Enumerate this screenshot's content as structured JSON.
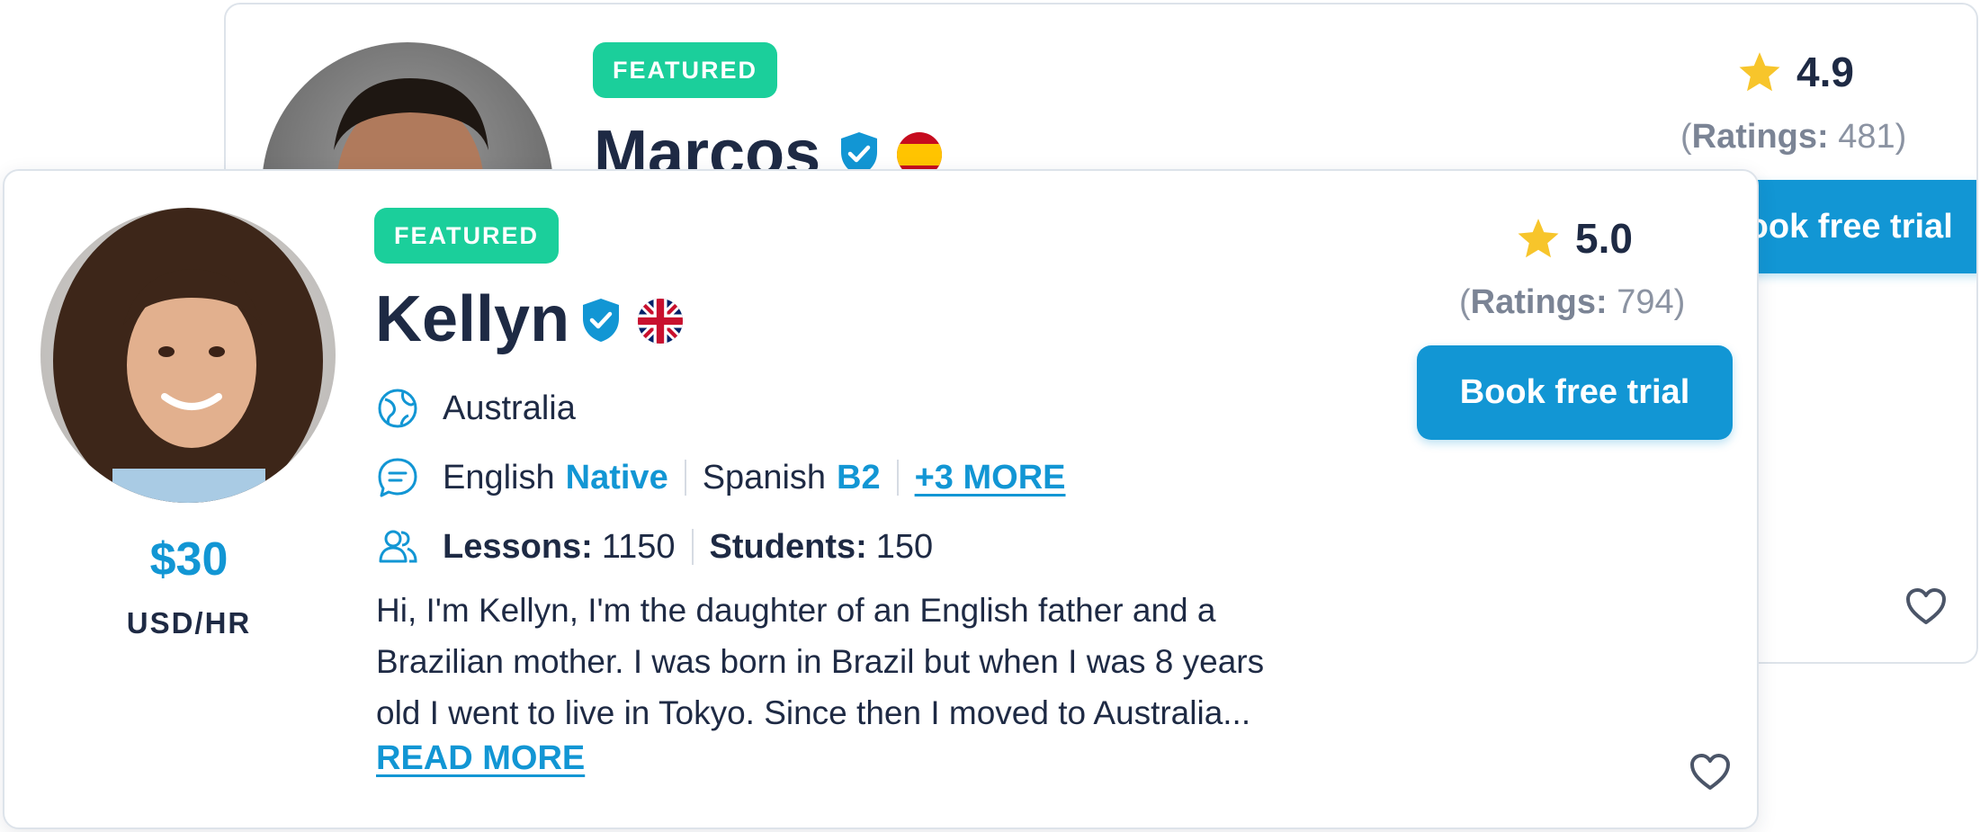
{
  "colors": {
    "featured_badge": "#1bcf9b",
    "accent_blue": "#1296d4",
    "star": "#f7c52b",
    "text_dark": "#1e2a44",
    "text_muted": "#8b93a2"
  },
  "back_card": {
    "badge": "FEATURED",
    "name": "Marcos",
    "flag": "spain-flag-icon",
    "rating": "4.9",
    "ratings_label": "Ratings:",
    "ratings_count": "481",
    "book_button": "Book free trial"
  },
  "front_card": {
    "badge": "FEATURED",
    "name": "Kellyn",
    "flag": "uk-flag-icon",
    "location": "Australia",
    "languages": [
      {
        "name": "English",
        "level": "Native"
      },
      {
        "name": "Spanish",
        "level": "B2"
      }
    ],
    "more_languages": "+3 MORE",
    "lessons_label": "Lessons:",
    "lessons_value": "1150",
    "students_label": "Students:",
    "students_value": "150",
    "bio_lines": [
      "Hi, I'm Kellyn, I'm the daughter of an English  father and a",
      "Brazilian mother. I was born in Brazil but when I was 8 years",
      "old I went to live in Tokyo. Since then I moved to Australia..."
    ],
    "read_more": "READ MORE",
    "price": "$30",
    "price_unit": "USD/HR",
    "rating": "5.0",
    "ratings_label": "Ratings:",
    "ratings_count": "794",
    "book_button": "Book free trial"
  }
}
